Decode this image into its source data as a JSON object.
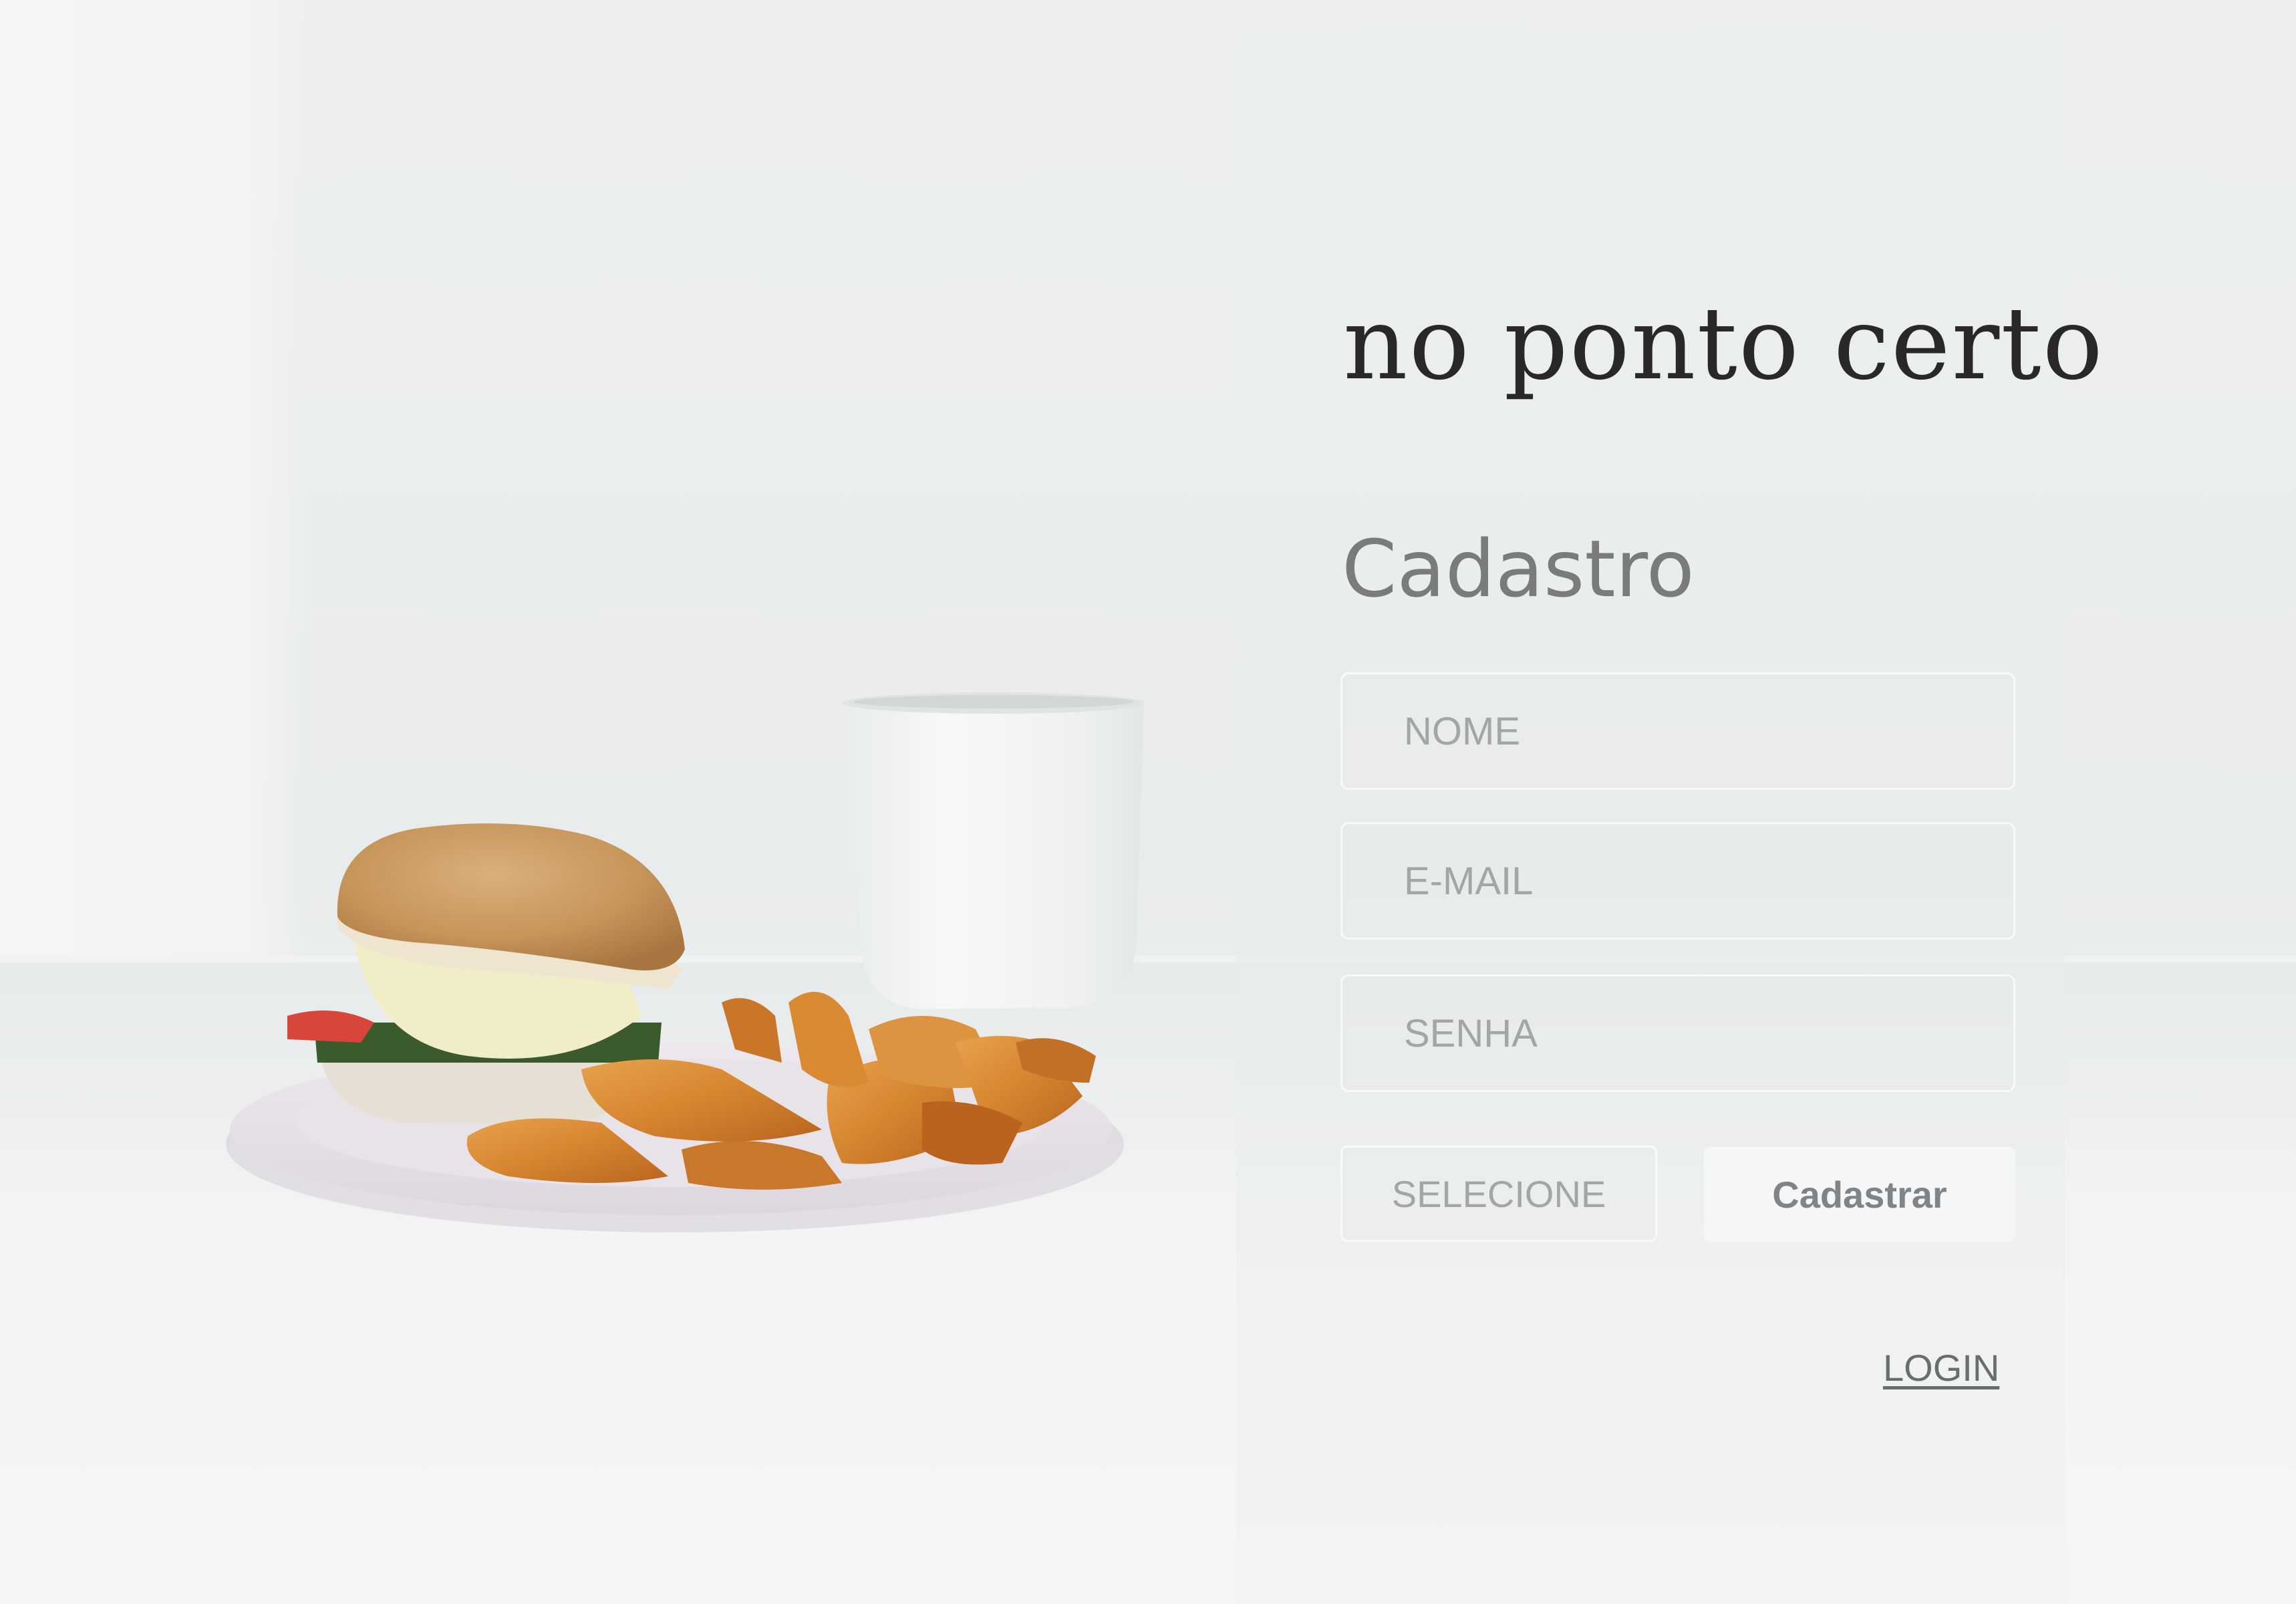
{
  "brand": {
    "name": "no ponto certo"
  },
  "form": {
    "title": "Cadastro",
    "fields": {
      "name_placeholder": "NOME",
      "email_placeholder": "E-MAIL",
      "password_placeholder": "SENHA"
    },
    "select_label": "SELECIONE",
    "submit_label": "Cadastrar",
    "login_link": "LOGIN"
  },
  "colors": {
    "background": "#eef0ef",
    "brand_text": "#2a2826",
    "title_text": "#7a7b7b",
    "field_border": "#f8f9f9",
    "placeholder_text": "#a3a6a6",
    "button_bg": "#f5f6f7",
    "button_text": "#808486"
  }
}
